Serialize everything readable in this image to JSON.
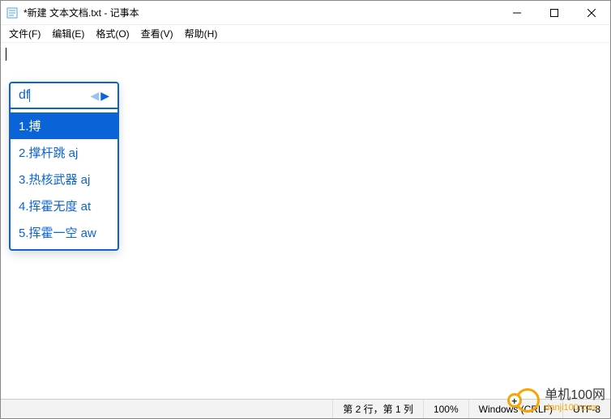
{
  "titlebar": {
    "title": "*新建 文本文档.txt - 记事本"
  },
  "menu": {
    "file": "文件(F)",
    "edit": "编辑(E)",
    "format": "格式(O)",
    "view": "查看(V)",
    "help": "帮助(H)"
  },
  "ime": {
    "composition": "df",
    "candidates": [
      {
        "label": "1.搏",
        "selected": true
      },
      {
        "label": "2.撑杆跳 aj",
        "selected": false
      },
      {
        "label": "3.热核武器 aj",
        "selected": false
      },
      {
        "label": "4.挥霍无度 at",
        "selected": false
      },
      {
        "label": "5.挥霍一空 aw",
        "selected": false
      }
    ]
  },
  "statusbar": {
    "position": "第 2 行，第 1 列",
    "zoom": "100%",
    "line_ending": "Windows (CRLF)",
    "encoding": "UTF-8"
  },
  "watermark": {
    "name_cn": "单机100网",
    "name_en": "danji100.com"
  }
}
